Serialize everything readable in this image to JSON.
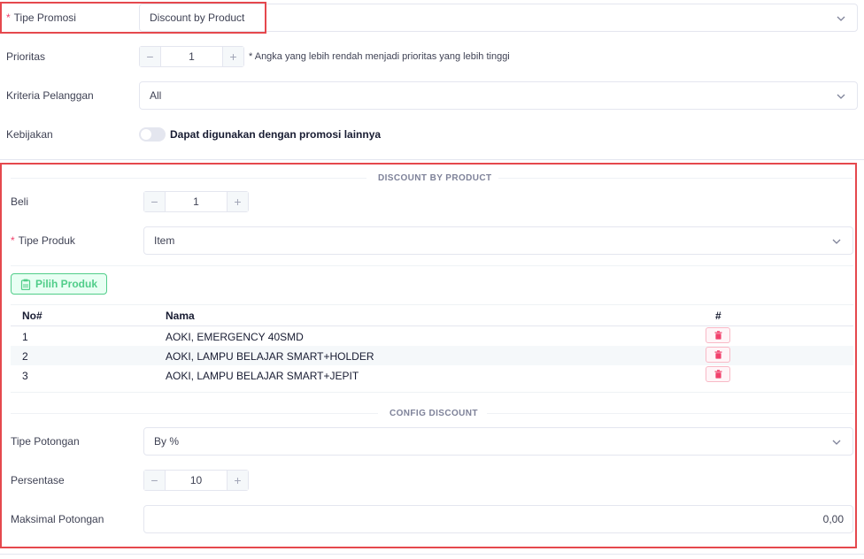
{
  "top": {
    "tipe_promosi": {
      "label": "Tipe Promosi",
      "value": "Discount by Product"
    },
    "prioritas": {
      "label": "Prioritas",
      "value": "1",
      "note": "* Angka yang lebih rendah menjadi prioritas yang lebih tinggi"
    },
    "kriteria": {
      "label": "Kriteria Pelanggan",
      "value": "All"
    },
    "kebijakan": {
      "label": "Kebijakan",
      "toggle_label": "Dapat digunakan dengan promosi lainnya",
      "enabled": false
    }
  },
  "section": {
    "title": "DISCOUNT BY PRODUCT",
    "beli": {
      "label": "Beli",
      "value": "1"
    },
    "tipe_produk": {
      "label": "Tipe Produk",
      "value": "Item"
    },
    "pilih_button": "Pilih Produk",
    "table": {
      "headers": {
        "no": "No#",
        "nama": "Nama",
        "action": "#"
      },
      "rows": [
        {
          "no": "1",
          "nama": "AOKI, EMERGENCY 40SMD"
        },
        {
          "no": "2",
          "nama": "AOKI, LAMPU BELAJAR SMART+HOLDER"
        },
        {
          "no": "3",
          "nama": "AOKI, LAMPU BELAJAR SMART+JEPIT"
        }
      ]
    }
  },
  "config": {
    "title": "CONFIG DISCOUNT",
    "tipe_potongan": {
      "label": "Tipe Potongan",
      "value": "By %"
    },
    "persentase": {
      "label": "Persentase",
      "value": "10"
    },
    "maksimal": {
      "label": "Maksimal Potongan",
      "value": "0,00"
    }
  },
  "colors": {
    "highlight": "#e5484d",
    "success": "#50cd89",
    "danger": "#f1416c"
  }
}
